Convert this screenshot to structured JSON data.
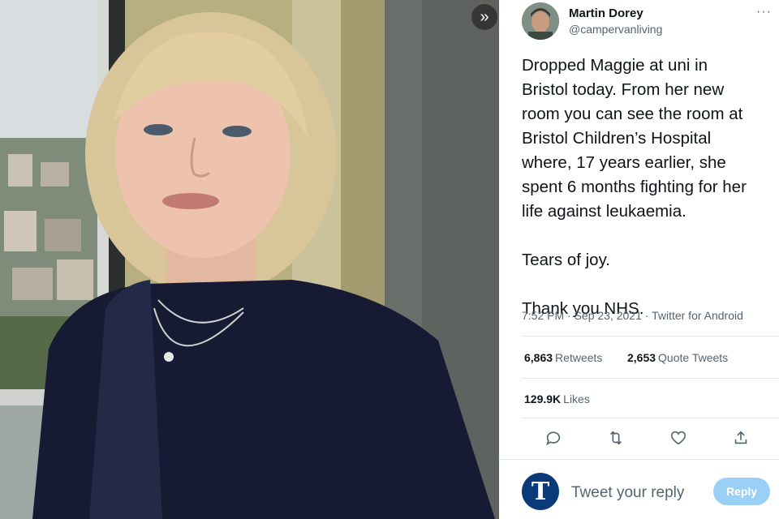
{
  "tweet": {
    "author_name": "Martin Dorey",
    "author_handle": "@campervanliving",
    "more_label": "···",
    "lines": [
      "Dropped Maggie at uni in",
      "Bristol today. From her new",
      "room you can see the room at",
      "Bristol Children’s Hospital",
      "where, 17 years earlier, she",
      "spent 6 months fighting for her",
      "life against leukaemia."
    ],
    "line_tears": "Tears of joy.",
    "line_thanks": "Thank you NHS.",
    "timestamp": "7:52 PM · Sep 23, 2021 · Twitter for Android",
    "stats": {
      "retweets_count": "6,863",
      "retweets_label": "Retweets",
      "quotes_count": "2,653",
      "quotes_label": "Quote Tweets",
      "likes_count": "129.9K",
      "likes_label": "Likes"
    },
    "actions": [
      "reply-icon",
      "retweet-icon",
      "like-icon",
      "share-icon"
    ]
  },
  "reply": {
    "placeholder": "Tweet your reply",
    "button_label": "Reply",
    "logo_letter": "T"
  },
  "photo": {
    "expand_icon": "»"
  },
  "colors": {
    "accent": "#1d9bf0",
    "reply_button": "#9ad0f5",
    "muted": "#536471",
    "logo_bg": "#0b3a7a"
  }
}
